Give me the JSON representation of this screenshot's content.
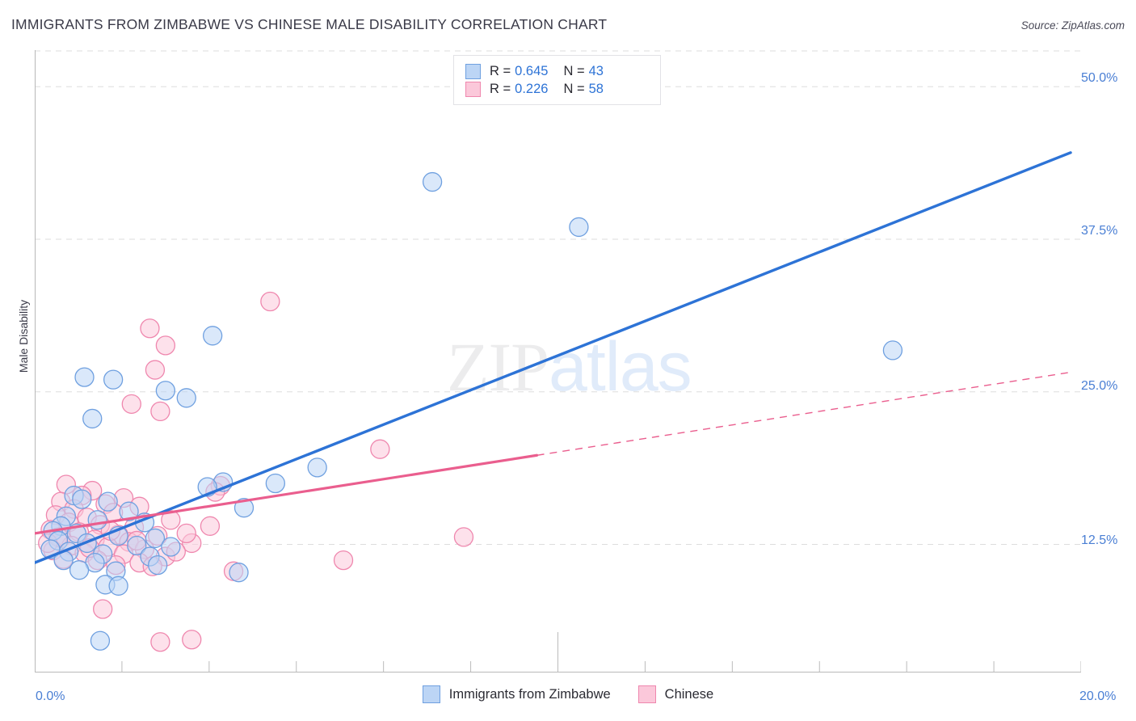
{
  "header": {
    "title": "IMMIGRANTS FROM ZIMBABWE VS CHINESE MALE DISABILITY CORRELATION CHART",
    "source": "Source: ZipAtlas.com"
  },
  "watermark": {
    "part1": "ZIP",
    "part2": "atlas"
  },
  "stats_legend": {
    "rows": [
      {
        "color": "#bcd5f5",
        "r_label": "R =",
        "r_value": "0.645",
        "n_label": "N =",
        "n_value": "43"
      },
      {
        "color": "#fbc8da",
        "r_label": "R =",
        "r_value": "0.226",
        "n_label": "N =",
        "n_value": "58"
      }
    ]
  },
  "bottom_legend": {
    "items": [
      {
        "label": "Immigrants from Zimbabwe",
        "color": "#bcd5f5"
      },
      {
        "label": "Chinese",
        "color": "#fbc8da"
      }
    ]
  },
  "axes": {
    "y_title": "Male Disability",
    "y_ticks": [
      "50.0%",
      "37.5%",
      "25.0%",
      "12.5%"
    ],
    "x_ticks": [
      "0.0%",
      "20.0%"
    ]
  },
  "chart_data": {
    "type": "scatter",
    "title": "IMMIGRANTS FROM ZIMBABWE VS CHINESE MALE DISABILITY CORRELATION CHART",
    "xlabel": "",
    "ylabel": "Male Disability",
    "xlim": [
      0.0,
      20.0
    ],
    "ylim": [
      2.0,
      53.0
    ],
    "x_tick_values": [
      0.0,
      20.0
    ],
    "y_tick_values": [
      12.5,
      25.0,
      37.5,
      50.0
    ],
    "grid": "horizontal-dashed",
    "legend_position": "bottom-center",
    "series": [
      {
        "name": "Immigrants from Zimbabwe",
        "color": "#bcd5f5",
        "stroke": "#6fa0e0",
        "R": 0.645,
        "N": 43,
        "trendline": {
          "x0": 0.0,
          "y0": 11.0,
          "x1": 19.8,
          "y1": 44.6,
          "style": "solid",
          "color": "#2d73d6"
        },
        "points": [
          [
            7.6,
            42.2
          ],
          [
            10.4,
            38.5
          ],
          [
            16.4,
            28.4
          ],
          [
            3.4,
            29.6
          ],
          [
            0.95,
            26.2
          ],
          [
            1.5,
            26.0
          ],
          [
            2.5,
            25.1
          ],
          [
            2.9,
            24.5
          ],
          [
            1.1,
            22.8
          ],
          [
            5.4,
            18.8
          ],
          [
            3.6,
            17.6
          ],
          [
            4.6,
            17.5
          ],
          [
            3.3,
            17.2
          ],
          [
            0.75,
            16.5
          ],
          [
            0.9,
            16.2
          ],
          [
            1.4,
            16.0
          ],
          [
            4.0,
            15.5
          ],
          [
            1.8,
            15.2
          ],
          [
            0.6,
            14.8
          ],
          [
            1.2,
            14.5
          ],
          [
            2.1,
            14.3
          ],
          [
            0.5,
            14.0
          ],
          [
            0.35,
            13.6
          ],
          [
            0.8,
            13.4
          ],
          [
            1.6,
            13.2
          ],
          [
            2.3,
            13.0
          ],
          [
            0.45,
            12.8
          ],
          [
            1.0,
            12.6
          ],
          [
            1.95,
            12.4
          ],
          [
            2.6,
            12.3
          ],
          [
            0.3,
            12.1
          ],
          [
            0.65,
            11.9
          ],
          [
            1.3,
            11.7
          ],
          [
            2.2,
            11.5
          ],
          [
            0.55,
            11.2
          ],
          [
            1.15,
            11.0
          ],
          [
            2.35,
            10.8
          ],
          [
            0.85,
            10.4
          ],
          [
            1.55,
            10.3
          ],
          [
            3.9,
            10.2
          ],
          [
            1.35,
            9.2
          ],
          [
            1.6,
            9.1
          ],
          [
            1.25,
            4.6
          ]
        ]
      },
      {
        "name": "Chinese",
        "color": "#fbc8da",
        "stroke": "#ef87ae",
        "R": 0.226,
        "N": 58,
        "trendline": {
          "x0": 0.0,
          "y0": 13.4,
          "x1": 19.8,
          "y1": 26.6,
          "style": "solid-then-dashed",
          "dash_start_x": 9.6,
          "color": "#ea5e8e"
        },
        "points": [
          [
            4.5,
            32.4
          ],
          [
            2.2,
            30.2
          ],
          [
            2.5,
            28.8
          ],
          [
            2.3,
            26.8
          ],
          [
            1.85,
            24.0
          ],
          [
            2.4,
            23.4
          ],
          [
            6.6,
            20.3
          ],
          [
            3.55,
            17.3
          ],
          [
            3.45,
            16.8
          ],
          [
            0.6,
            17.4
          ],
          [
            1.1,
            16.9
          ],
          [
            0.9,
            16.5
          ],
          [
            1.7,
            16.3
          ],
          [
            0.5,
            16.0
          ],
          [
            1.35,
            15.8
          ],
          [
            2.0,
            15.6
          ],
          [
            0.75,
            15.4
          ],
          [
            1.5,
            15.1
          ],
          [
            0.4,
            14.9
          ],
          [
            1.0,
            14.7
          ],
          [
            2.6,
            14.5
          ],
          [
            0.65,
            14.3
          ],
          [
            1.25,
            14.1
          ],
          [
            1.9,
            13.9
          ],
          [
            0.3,
            13.7
          ],
          [
            0.85,
            13.5
          ],
          [
            1.6,
            13.3
          ],
          [
            2.35,
            13.2
          ],
          [
            0.5,
            13.0
          ],
          [
            1.15,
            12.9
          ],
          [
            1.8,
            12.7
          ],
          [
            3.0,
            12.6
          ],
          [
            0.7,
            12.4
          ],
          [
            1.4,
            12.3
          ],
          [
            2.1,
            12.1
          ],
          [
            0.35,
            12.0
          ],
          [
            0.95,
            11.8
          ],
          [
            1.7,
            11.7
          ],
          [
            2.5,
            11.5
          ],
          [
            0.55,
            11.3
          ],
          [
            1.2,
            11.2
          ],
          [
            2.0,
            11.0
          ],
          [
            3.35,
            14.0
          ],
          [
            8.2,
            13.1
          ],
          [
            5.9,
            11.2
          ],
          [
            1.55,
            10.8
          ],
          [
            2.25,
            10.7
          ],
          [
            3.8,
            10.3
          ],
          [
            0.45,
            13.1
          ],
          [
            1.05,
            12.2
          ],
          [
            1.95,
            12.8
          ],
          [
            2.7,
            11.9
          ],
          [
            0.25,
            12.6
          ],
          [
            1.45,
            13.6
          ],
          [
            2.9,
            13.4
          ],
          [
            1.3,
            7.2
          ],
          [
            2.4,
            4.5
          ],
          [
            3.0,
            4.7
          ]
        ]
      }
    ]
  }
}
